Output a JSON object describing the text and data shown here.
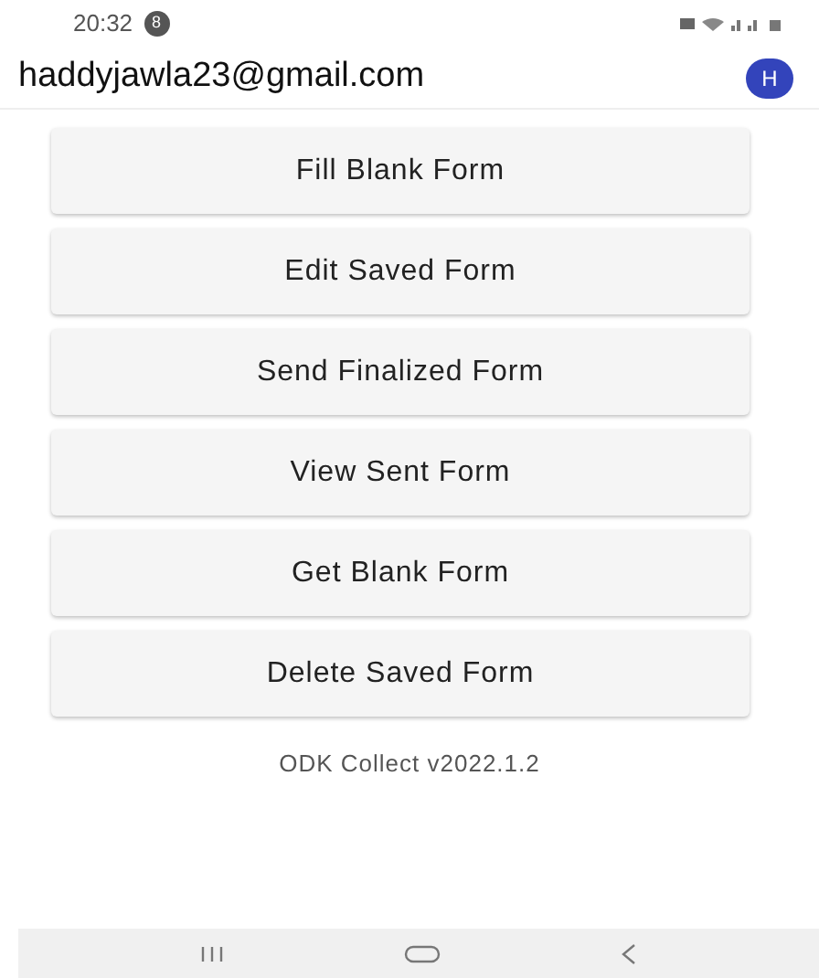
{
  "status_bar": {
    "time": "20:32",
    "notification_count": "8"
  },
  "header": {
    "account": "haddyjawla23@gmail.com",
    "avatar_letter": "H"
  },
  "buttons": [
    "Fill Blank Form",
    "Edit Saved Form",
    "Send Finalized Form",
    "View Sent Form",
    "Get Blank Form",
    "Delete Saved Form"
  ],
  "version": "ODK Collect v2022.1.2"
}
